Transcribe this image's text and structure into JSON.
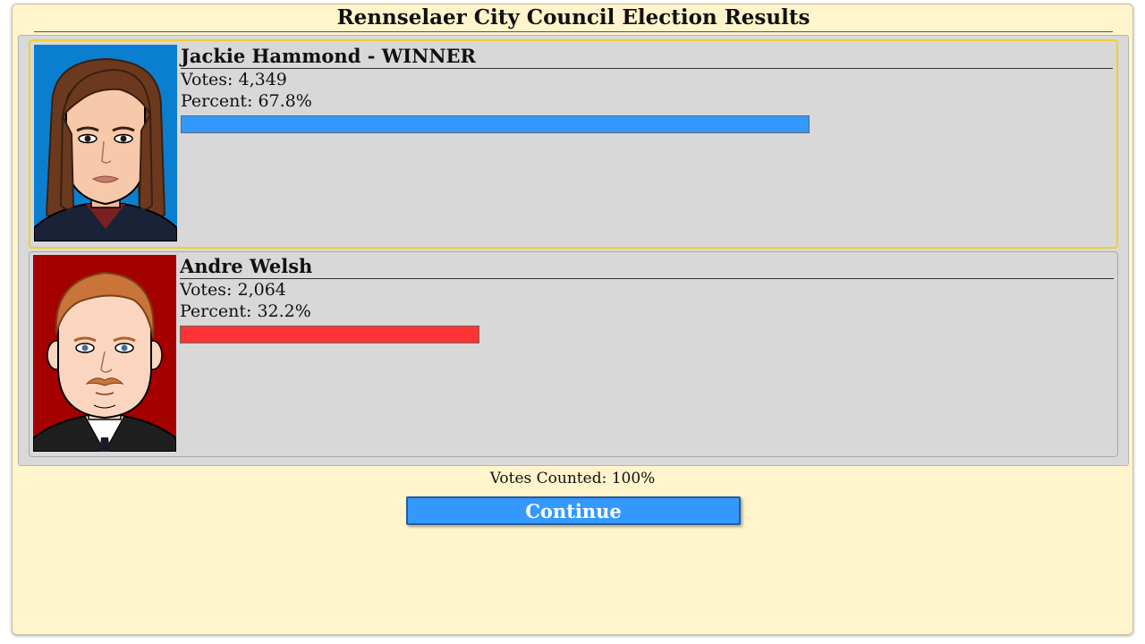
{
  "title": "Rennselaer City Council Election Results",
  "candidates": [
    {
      "name": "Jackie Hammond - WINNER",
      "votes_label": "Votes:",
      "votes": "4,349",
      "percent_label": "Percent:",
      "percent": "67.8%",
      "percent_value": 67.8,
      "bar_color": "#3399ff",
      "portrait_bg": "#0a7fd0",
      "winner": true
    },
    {
      "name": "Andre Welsh",
      "votes_label": "Votes:",
      "votes": "2,064",
      "percent_label": "Percent:",
      "percent": "32.2%",
      "percent_value": 32.2,
      "bar_color": "#ff3333",
      "portrait_bg": "#a50000",
      "winner": false
    }
  ],
  "votes_counted": "Votes Counted: 100%",
  "continue_label": "Continue",
  "colors": {
    "panel_bg": "#fff4cb",
    "winner_border": "#f2cf2e",
    "button_bg": "#3399ff"
  }
}
